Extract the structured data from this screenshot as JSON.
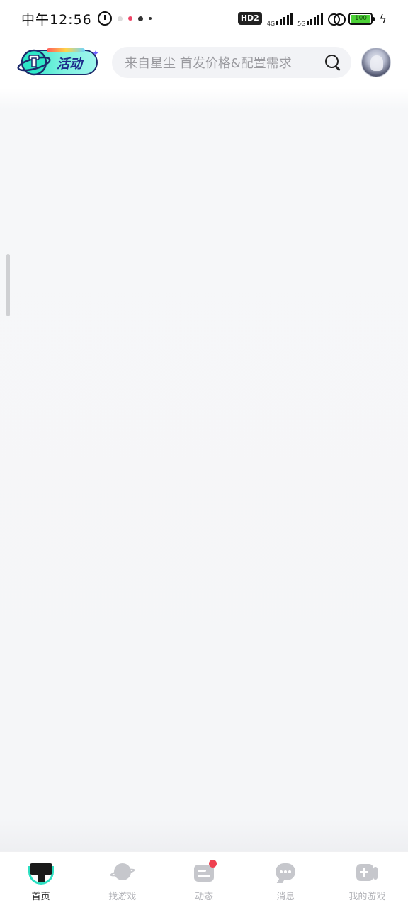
{
  "status_bar": {
    "time": "中午12:56",
    "hd_badge": "HD2",
    "network_1": "4G",
    "network_2": "5G",
    "battery_level": "100"
  },
  "header": {
    "activity_label": "活动",
    "search": {
      "placeholder": "来自星尘 首发价格&配置需求"
    }
  },
  "bottom_nav": {
    "items": [
      {
        "label": "首页",
        "icon": "home-icon",
        "active": true
      },
      {
        "label": "找游戏",
        "icon": "planet-icon",
        "active": false
      },
      {
        "label": "动态",
        "icon": "feed-icon",
        "active": false,
        "badge": true
      },
      {
        "label": "消息",
        "icon": "message-icon",
        "active": false
      },
      {
        "label": "我的游戏",
        "icon": "gamepad-icon",
        "active": false
      }
    ]
  },
  "colors": {
    "accent": "#2de0c2",
    "badge_red": "#ef4050",
    "inactive": "#b4b5ba"
  }
}
